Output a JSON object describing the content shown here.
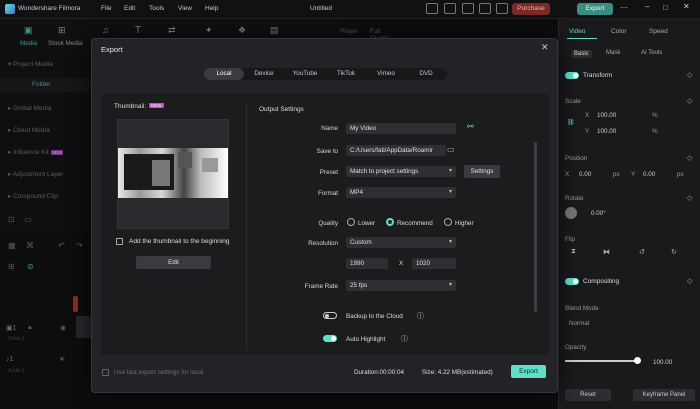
{
  "app": {
    "name": "Wondershare Filmora",
    "title": "Untitled"
  },
  "menu": [
    "File",
    "Edit",
    "Tools",
    "View",
    "Help"
  ],
  "topbar": {
    "purchase": "Purchase",
    "export": "Export"
  },
  "toolbar": {
    "media": "Media",
    "stock_media": "Stock Media",
    "player": "Player",
    "quality": "Full Quality"
  },
  "left_panel": {
    "items": [
      "Project Media",
      "Folder",
      "Global Media",
      "Cloud Media",
      "Influence Kit",
      "Adjustment Layer",
      "Compound Clip"
    ],
    "new_badge": "NEW"
  },
  "timeline": {
    "video_track": "Video 1",
    "audio_track": "Audio 1"
  },
  "right_panel": {
    "tabs": [
      "Video",
      "Color",
      "Speed"
    ],
    "subtabs": [
      "Basic",
      "Mask",
      "AI Tools"
    ],
    "transform": "Transform",
    "scale": "Scale",
    "scale_x": "100.00",
    "scale_y": "100.00",
    "pct": "%",
    "position": "Position",
    "pos_x": "0.00",
    "pos_y": "0.00",
    "px": "px",
    "rotate": "Rotate",
    "rotate_val": "0.00°",
    "flip": "Flip",
    "compositing": "Compositing",
    "blend_mode": "Blend Mode",
    "blend_val": "Normal",
    "opacity": "Opacity",
    "opacity_val": "100.00",
    "reset": "Reset",
    "keyframe": "Keyframe Panel"
  },
  "export": {
    "title": "Export",
    "tabs": [
      "Local",
      "Device",
      "YouTube",
      "TikTok",
      "Vimeo",
      "DVD"
    ],
    "thumbnail_label": "Thumbnail:",
    "new_badge": "NEW",
    "thumb_checkbox": "Add the thumbnail to the beginning",
    "edit_button": "Edit",
    "output_settings": "Output Settings",
    "name_label": "Name",
    "name_value": "My Video",
    "save_label": "Save to",
    "save_value": "C:/Users/fati/AppData/Roamir",
    "preset_label": "Preset",
    "preset_value": "Match to project settings",
    "settings_button": "Settings",
    "format_label": "Format",
    "format_value": "MP4",
    "quality_label": "Quality",
    "quality_options": [
      "Lower",
      "Recommend",
      "Higher"
    ],
    "quality_selected": "Recommend",
    "resolution_label": "Resolution",
    "resolution_value": "Custom",
    "res_w": "1990",
    "res_x": "X",
    "res_h": "1020",
    "framerate_label": "Frame Rate",
    "framerate_value": "25 fps",
    "backup_label": "Backup to the Cloud",
    "highlight_label": "Auto Highlight",
    "last_settings": "Use last export settings for local",
    "duration": "Duration:00:00:04",
    "size": "Size: 4.22 MB(estimated)",
    "export_button": "Export"
  },
  "colors": {
    "accent": "#5ee0c8",
    "purchase": "#c0392b"
  }
}
